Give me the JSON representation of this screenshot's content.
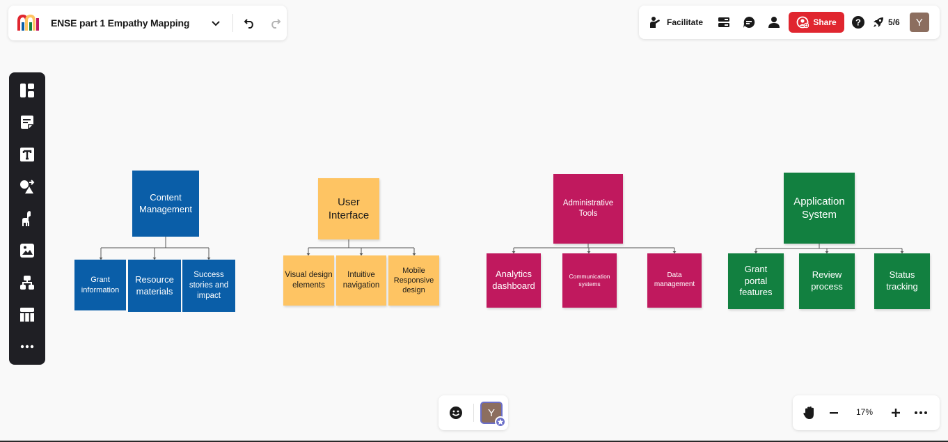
{
  "board": {
    "title": "ENSE part 1 Empathy Mapping"
  },
  "topbar": {
    "facilitate_label": "Facilitate",
    "share_label": "Share",
    "launch_count": "5/6",
    "user_initial": "Y"
  },
  "left_toolbar": {
    "tools": [
      "templates-icon",
      "sticky-note-icon",
      "text-icon",
      "shapes-icon",
      "llama-icon",
      "image-icon",
      "diagram-icon",
      "table-icon",
      "more-icon"
    ]
  },
  "mindmap": {
    "content": {
      "title": "Content Management",
      "children": [
        "Grant information",
        "Resource materials",
        "Success stories and impact"
      ]
    },
    "ui": {
      "title": "User Interface",
      "children": [
        "Visual design elements",
        "Intuitive navigation",
        "Mobile Responsive design"
      ]
    },
    "admin": {
      "title": "Administrative Tools",
      "children": [
        "Analytics dashboard",
        "Communication systems",
        "Data management"
      ]
    },
    "app": {
      "title": "Application System",
      "children": [
        "Grant portal features",
        "Review process",
        "Status tracking"
      ]
    }
  },
  "colors": {
    "blue": "#0a5ea8",
    "yellow": "#fec463",
    "magenta": "#c0195e",
    "green": "#128040",
    "share_red": "#e0262f"
  },
  "bottom": {
    "user_initial": "Y",
    "zoom_level": "17%"
  }
}
